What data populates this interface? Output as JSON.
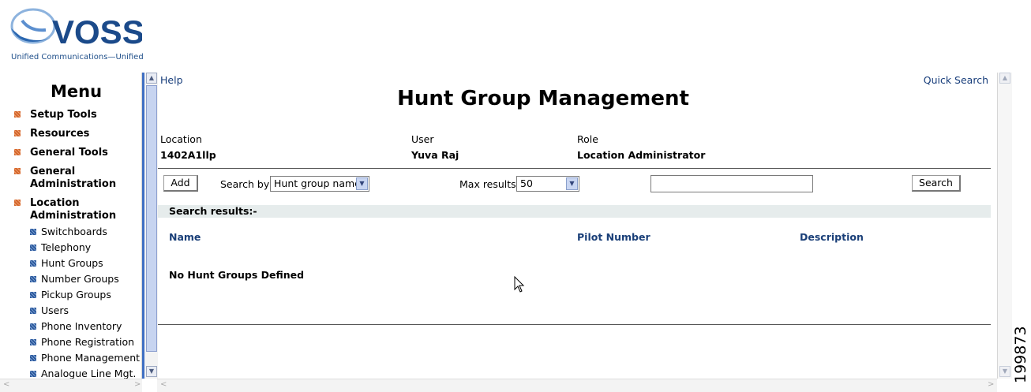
{
  "brand": {
    "name": "VOSS",
    "tagline": "Unified Communications—Unified"
  },
  "menu": {
    "title": "Menu",
    "categories": [
      {
        "label": "Setup Tools"
      },
      {
        "label": "Resources"
      },
      {
        "label": "General Tools"
      },
      {
        "label": "General Administration",
        "line1": "General",
        "line2": "Administration"
      },
      {
        "label": "Location Administration",
        "line1": "Location",
        "line2": "Administration"
      }
    ],
    "location_items": [
      "Switchboards",
      "Telephony",
      "Hunt Groups",
      "Number Groups",
      "Pickup Groups",
      "Users",
      "Phone Inventory",
      "Phone Registration",
      "Phone Management",
      "Analogue Line Mgt."
    ]
  },
  "header": {
    "help": "Help",
    "quick_search": "Quick Search",
    "title": "Hunt Group Management"
  },
  "context": {
    "location_label": "Location",
    "location_value": "1402A1llp",
    "user_label": "User",
    "user_value": "Yuva Raj",
    "role_label": "Role",
    "role_value": "Location Administrator"
  },
  "toolbar": {
    "add": "Add",
    "search_by_label": "Search by",
    "search_by_value": "Hunt group name",
    "max_results_label": "Max results",
    "max_results_value": "50",
    "search_query": "",
    "search": "Search"
  },
  "results": {
    "title": "Search results:-",
    "columns": [
      "Name",
      "Pilot Number",
      "Description"
    ],
    "empty_message": "No Hunt Groups Defined"
  },
  "figure_number": "199873",
  "colors": {
    "brand_blue": "#1b4a8a",
    "link": "#163c7a",
    "menu_bullet": "#d5662c",
    "sub_bullet": "#2e5a9c"
  }
}
